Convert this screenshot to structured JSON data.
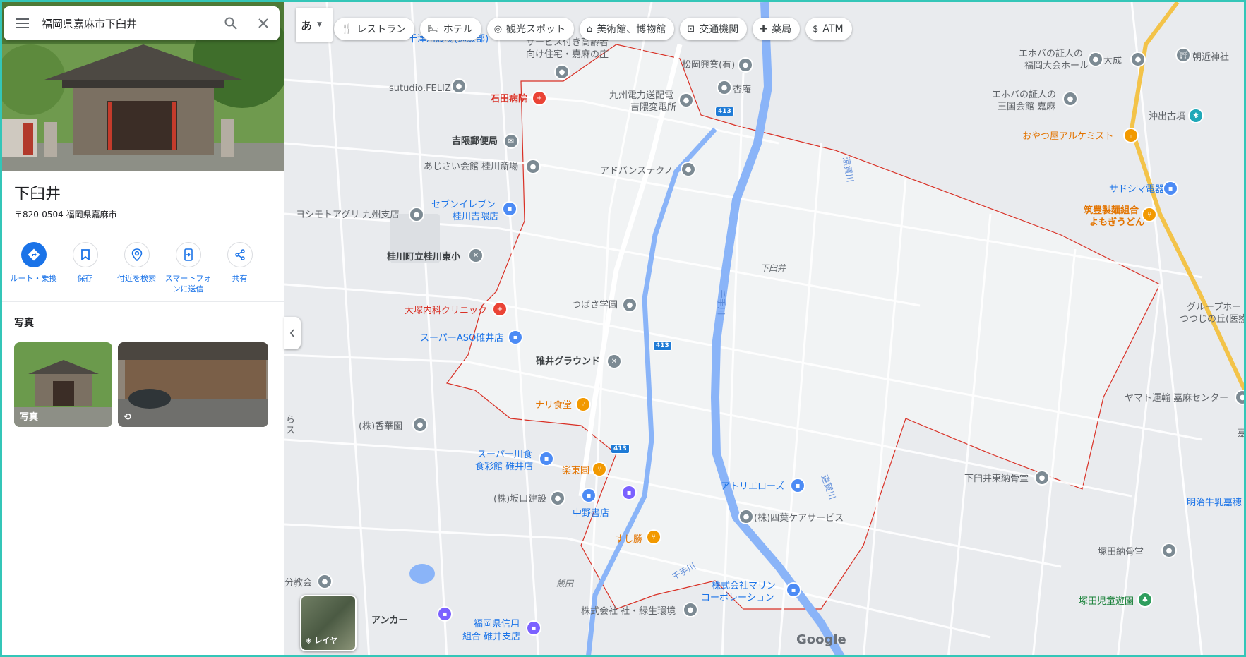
{
  "search": {
    "query": "福岡県嘉麻市下臼井"
  },
  "place": {
    "name": "下臼井",
    "address": "〒820-0504 福岡県嘉麻市"
  },
  "actions": [
    {
      "label": "ルート・乗換",
      "icon": "directions-icon"
    },
    {
      "label": "保存",
      "icon": "bookmark-icon"
    },
    {
      "label": "付近を検索",
      "icon": "nearby-search-icon"
    },
    {
      "label": "スマートフォンに送信",
      "icon": "send-to-phone-icon"
    },
    {
      "label": "共有",
      "icon": "share-icon"
    }
  ],
  "photos": {
    "title": "写真",
    "items": [
      {
        "caption": "写真"
      },
      {
        "caption": ""
      }
    ]
  },
  "chips": {
    "ime": "あ",
    "items": [
      {
        "label": "レストラン",
        "icon": "fork-knife-icon"
      },
      {
        "label": "ホテル",
        "icon": "bed-icon"
      },
      {
        "label": "観光スポット",
        "icon": "camera-icon"
      },
      {
        "label": "美術館、博物館",
        "icon": "museum-icon"
      },
      {
        "label": "交通機関",
        "icon": "train-icon"
      },
      {
        "label": "薬局",
        "icon": "pharmacy-icon"
      },
      {
        "label": "ATM",
        "icon": "atm-icon"
      }
    ]
  },
  "map": {
    "layers_label": "レイヤ",
    "logo": "Google",
    "labels": {
      "farm": "千津川農場(通販部)",
      "elderly_home": "サービス付き高齢者",
      "elderly_home2": "向け住宅・嘉麻の庄",
      "matsuoka": "松岡興業(有)",
      "kyoan": "杏庵",
      "studio": "sutudio.FELIZ",
      "ishida": "石田病院",
      "substation1": "九州電力送配電",
      "substation2": "吉隈変電所",
      "yoshikuma_post": "吉隈郵便局",
      "ajisai": "あじさい会館 桂川斎場",
      "advantec": "アドバンステクノ",
      "yoshimoto": "ヨシモトアグリ 九州支店",
      "seven1": "セブンイレブン",
      "seven2": "桂川吉隈店",
      "school": "桂川町立桂川東小",
      "otsuka": "大塚内科クリニック",
      "tsubasa": "つばさ学園",
      "aso": "スーパーASO碓井店",
      "ground": "碓井グラウンド",
      "area_name": "下臼井",
      "nari": "ナリ食堂",
      "kokahen": "(株)香華園",
      "super_kawa1": "スーパー川食",
      "super_kawa2": "食彩館 碓井店",
      "rakutoen": "楽東園",
      "sakaguchi": "(株)坂口建設",
      "nakano": "中野書店",
      "sushi": "すし勝",
      "atorie": "アトリエローズ",
      "yotsuba": "(株)四葉ケアサービス",
      "marine1": "株式会社マリン",
      "marine2": "コーポレーション",
      "shazo": "株式会社 社・緑生環境",
      "iida": "飯田",
      "anchor": "アンカー",
      "shinkin1": "福岡県信用",
      "shinkin2": "組合 碓井支店",
      "bunkaikan": "分教会",
      "jehovah1a": "エホバの証人の",
      "jehovah1b": "福岡大会ホール",
      "taisei": "大成",
      "asachika": "朝近神社",
      "jehovah2a": "エホバの証人の",
      "jehovah2b": "王国会館 嘉麻",
      "okidemae": "沖出古墳",
      "oyatsu": "おやつ屋アルケミスト",
      "sadoshima": "サドシマ電器",
      "chikuho1": "筑豊製麺組合",
      "chikuho2": "よもぎうどん",
      "group1": "グループホー",
      "group2": "つつじの丘(医療法",
      "yamato": "ヤマト運輸 嘉麻センター",
      "nosodo_e": "下臼井東納骨堂",
      "meiji": "明治牛乳嘉穂",
      "tsukada_n": "塚田納骨堂",
      "tsukada_p": "塚田児童遊園",
      "kama_edge": "嘉",
      "river_a": "遠賀川",
      "river_b": "千手川",
      "ri": "ら",
      "su": "ス",
      "road_413": "413"
    }
  }
}
